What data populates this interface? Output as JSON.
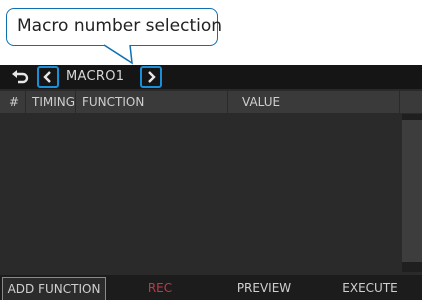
{
  "callout": {
    "text": "Macro number selection"
  },
  "titlebar": {
    "back_icon": "back-arrow-icon",
    "prev_icon": "chevron-left-icon",
    "next_icon": "chevron-right-icon",
    "macro_name": "MACRO1"
  },
  "table": {
    "headers": [
      "#",
      "TIMING",
      "FUNCTION",
      "VALUE"
    ]
  },
  "footer": {
    "buttons": [
      "ADD FUNCTION",
      "REC",
      "PREVIEW",
      "EXECUTE"
    ]
  },
  "colors": {
    "highlight": "#1a8fd8",
    "rec": "#c0394a",
    "callout_border": "#0f6fb3"
  }
}
